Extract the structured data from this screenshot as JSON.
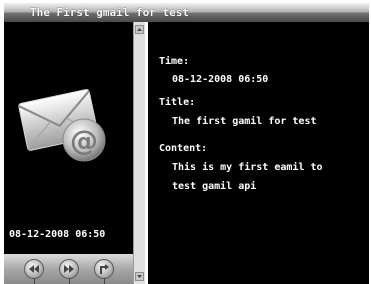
{
  "window": {
    "title": "The First gmail for test"
  },
  "preview": {
    "date": "08-12-2008 06:50",
    "icon": "email-envelope-icon"
  },
  "controls": [
    {
      "name": "previous-button",
      "icon": "previous-icon"
    },
    {
      "name": "next-button",
      "icon": "next-icon"
    },
    {
      "name": "return-button",
      "icon": "return-icon"
    }
  ],
  "detail": {
    "time_label": "Time:",
    "time_value": "08-12-2008 06:50",
    "title_label": "Title:",
    "title_value": "The first gamil for test",
    "content_label": "Content:",
    "content_line1": "This is my first eamil to",
    "content_line2": "test gamil api"
  },
  "colors": {
    "background": "#000000",
    "text": "#ffffff"
  }
}
